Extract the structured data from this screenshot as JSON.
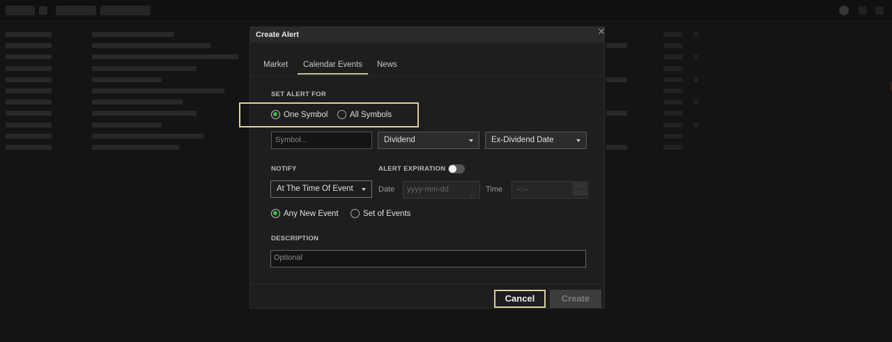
{
  "dialog": {
    "title": "Create Alert",
    "close_icon": "close-icon"
  },
  "tabs": [
    {
      "label": "Market",
      "active": false
    },
    {
      "label": "Calendar Events",
      "active": true
    },
    {
      "label": "News",
      "active": false
    }
  ],
  "set_alert_for": {
    "label": "SET ALERT FOR",
    "options": [
      {
        "label": "One Symbol",
        "selected": true
      },
      {
        "label": "All Symbols",
        "selected": false
      }
    ]
  },
  "symbol_input": {
    "placeholder": "Symbol..."
  },
  "event_type_select": {
    "value": "Dividend"
  },
  "event_field_select": {
    "value": "Ex-Dividend Date"
  },
  "notify": {
    "label": "NOTIFY",
    "timing_select": {
      "value": "At The Time Of Event"
    },
    "options": [
      {
        "label": "Any New Event",
        "selected": true
      },
      {
        "label": "Set of Events",
        "selected": false
      }
    ]
  },
  "alert_expiration": {
    "label": "ALERT EXPIRATION",
    "enabled": false,
    "date_label": "Date",
    "date_placeholder": "yyyy-mm-dd",
    "time_label": "Time",
    "time_placeholder": "--:--"
  },
  "description": {
    "label": "DESCRIPTION",
    "placeholder": "Optional"
  },
  "footer": {
    "cancel_label": "Cancel",
    "create_label": "Create"
  },
  "colors": {
    "accent_highlight": "#d9d3a0",
    "radio_selected": "#2fbf44",
    "dialog_bg": "#1e1e1e",
    "header_bg": "#2a2a2a"
  }
}
